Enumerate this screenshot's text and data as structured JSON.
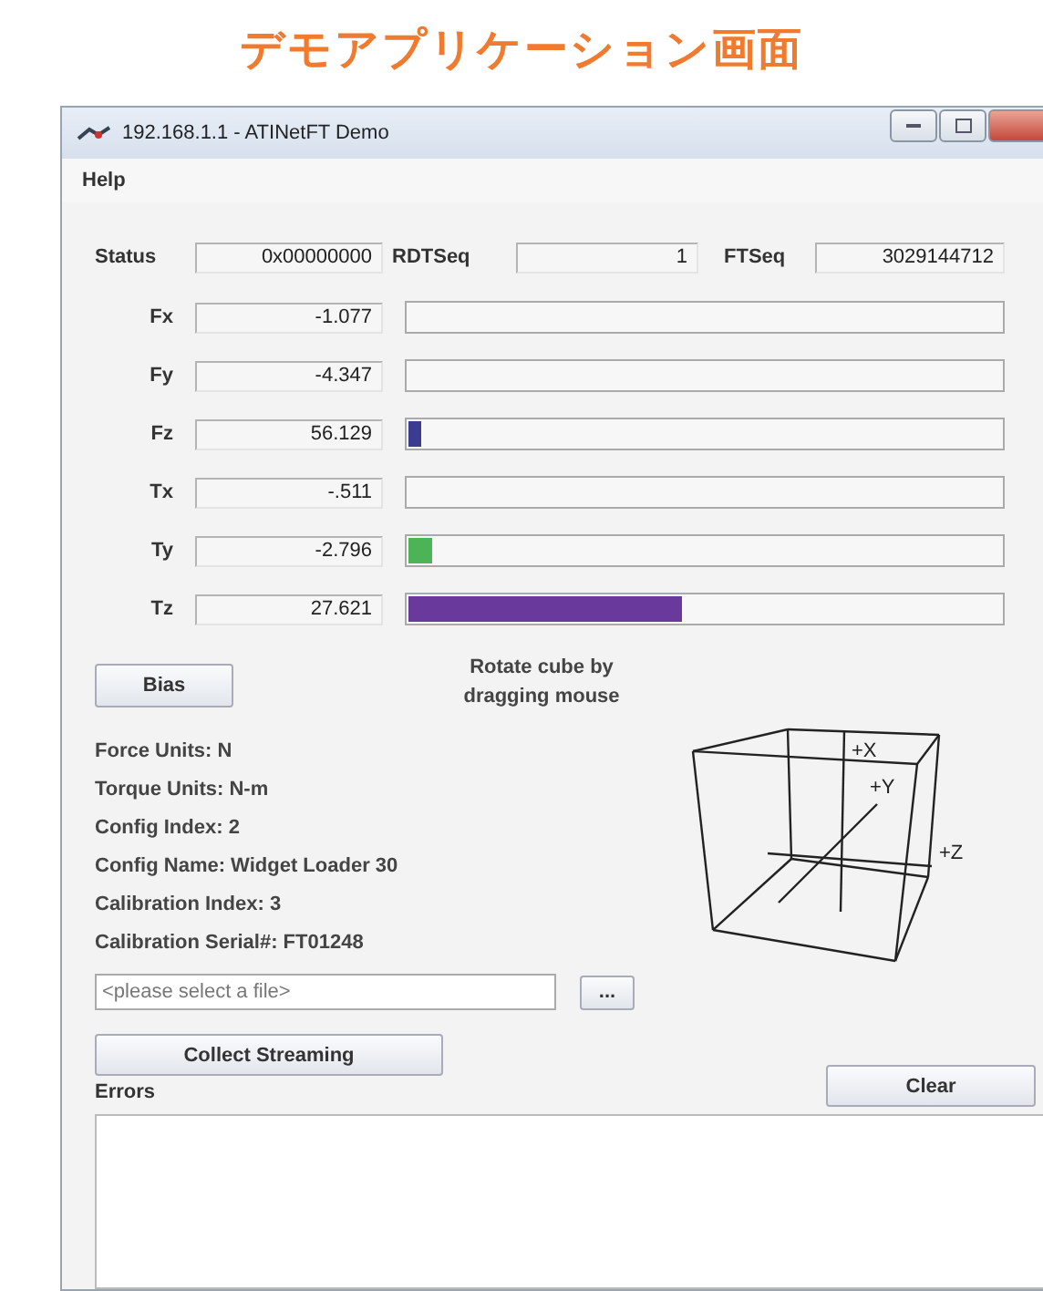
{
  "heading": "デモアプリケーション画面",
  "window": {
    "title": "192.168.1.1 - ATINetFT Demo"
  },
  "menu": [
    "Help"
  ],
  "status_fields": [
    {
      "label": "Status",
      "value": "0x00000000"
    },
    {
      "label": "RDTSeq",
      "value": "1"
    },
    {
      "label": "FTSeq",
      "value": "3029144712"
    }
  ],
  "channels": [
    {
      "name": "Fx",
      "reading": "-1.077"
    },
    {
      "name": "Fy",
      "reading": "-4.347"
    },
    {
      "name": "Fz",
      "reading": "56.129",
      "level": 0.02,
      "color": "#3b3b8f"
    },
    {
      "name": "Tx",
      "reading": "-.511"
    },
    {
      "name": "Ty",
      "reading": "-2.796",
      "level": 0.04,
      "color": "#4db357"
    },
    {
      "name": "Tz",
      "reading": "27.621",
      "level": 0.46,
      "color": "#693a9c"
    }
  ],
  "bias_button": "Bias",
  "cube": {
    "hint": "Rotate cube by dragging mouse",
    "axis_labels": [
      "+X",
      "+Y",
      "+Z"
    ]
  },
  "info": [
    "Force Units: N",
    "Torque Units: N-m",
    "Config Index: 2",
    "Config Name: Widget Loader 30",
    "Calibration Index: 3",
    "Calibration Serial#: FT01248"
  ],
  "file_field": {
    "placeholder": "<please select a file>"
  },
  "browse_button": "...",
  "collect_button": "Collect Streaming",
  "errors": {
    "label": "Errors",
    "clear_button": "Clear"
  }
}
